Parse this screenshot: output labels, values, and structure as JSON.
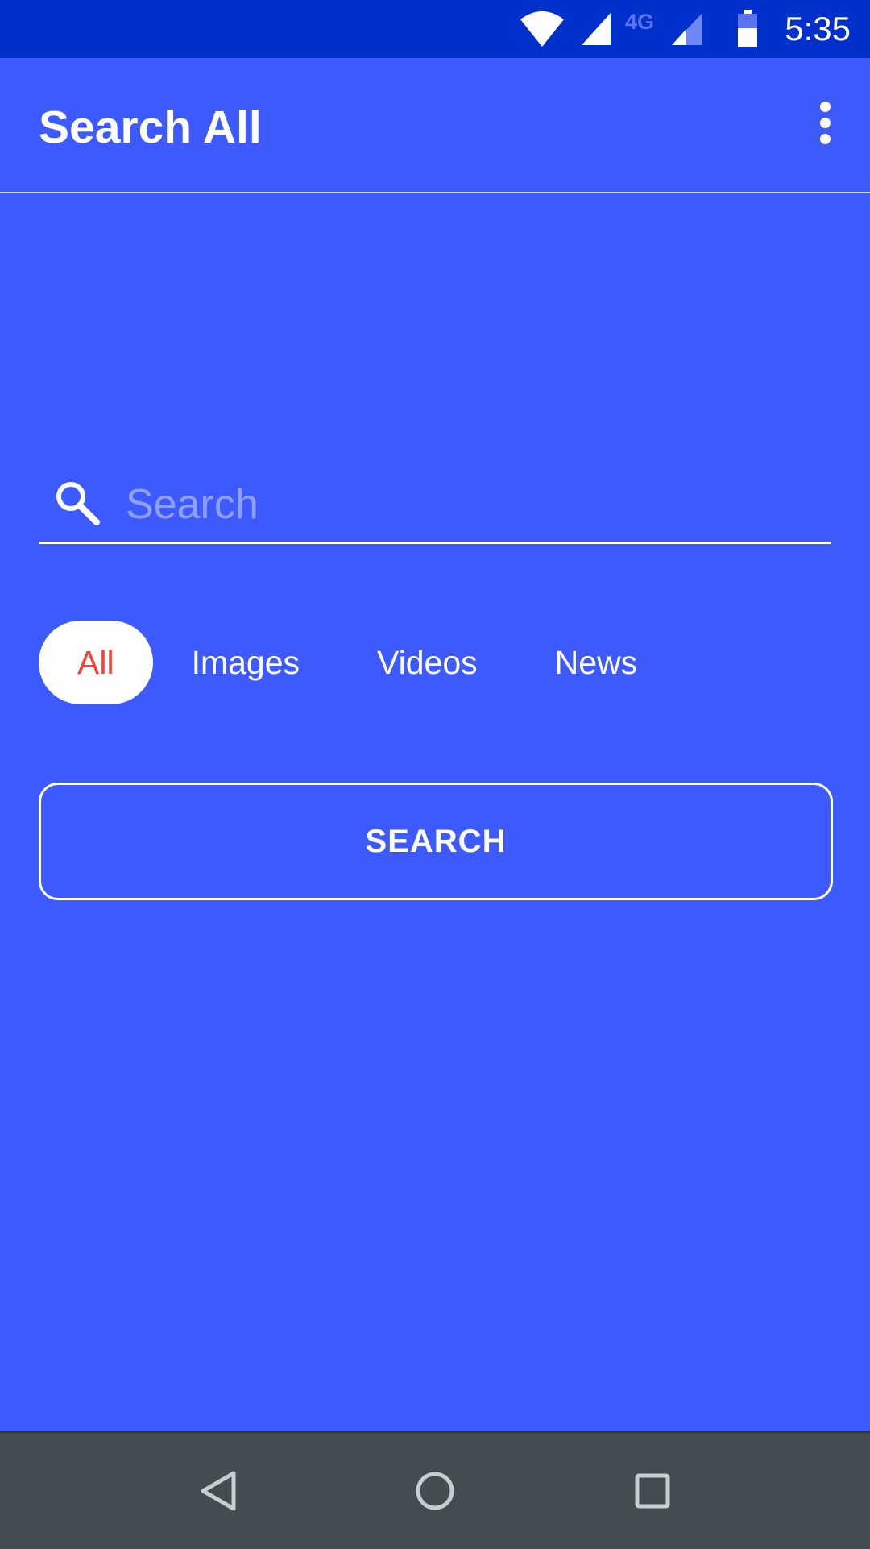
{
  "status_bar": {
    "time": "5:35",
    "network_label": "4G",
    "icons": [
      "wifi-icon",
      "cell-signal-icon",
      "cell-signal-weak-icon",
      "battery-icon"
    ]
  },
  "app_bar": {
    "title": "Search All",
    "overflow_icon": "more-vert-icon"
  },
  "search": {
    "placeholder": "Search",
    "value": "",
    "icon": "search-icon"
  },
  "tabs": [
    {
      "label": "All",
      "active": true
    },
    {
      "label": "Images",
      "active": false
    },
    {
      "label": "Videos",
      "active": false
    },
    {
      "label": "News",
      "active": false
    }
  ],
  "search_button": {
    "label": "SEARCH"
  },
  "nav_bar": {
    "icons": [
      "back-icon",
      "home-icon",
      "recents-icon"
    ]
  },
  "colors": {
    "background": "#3d5afe",
    "status_bar": "#0030cc",
    "active_tab_text": "#f44336",
    "nav_bar": "#444c52"
  }
}
